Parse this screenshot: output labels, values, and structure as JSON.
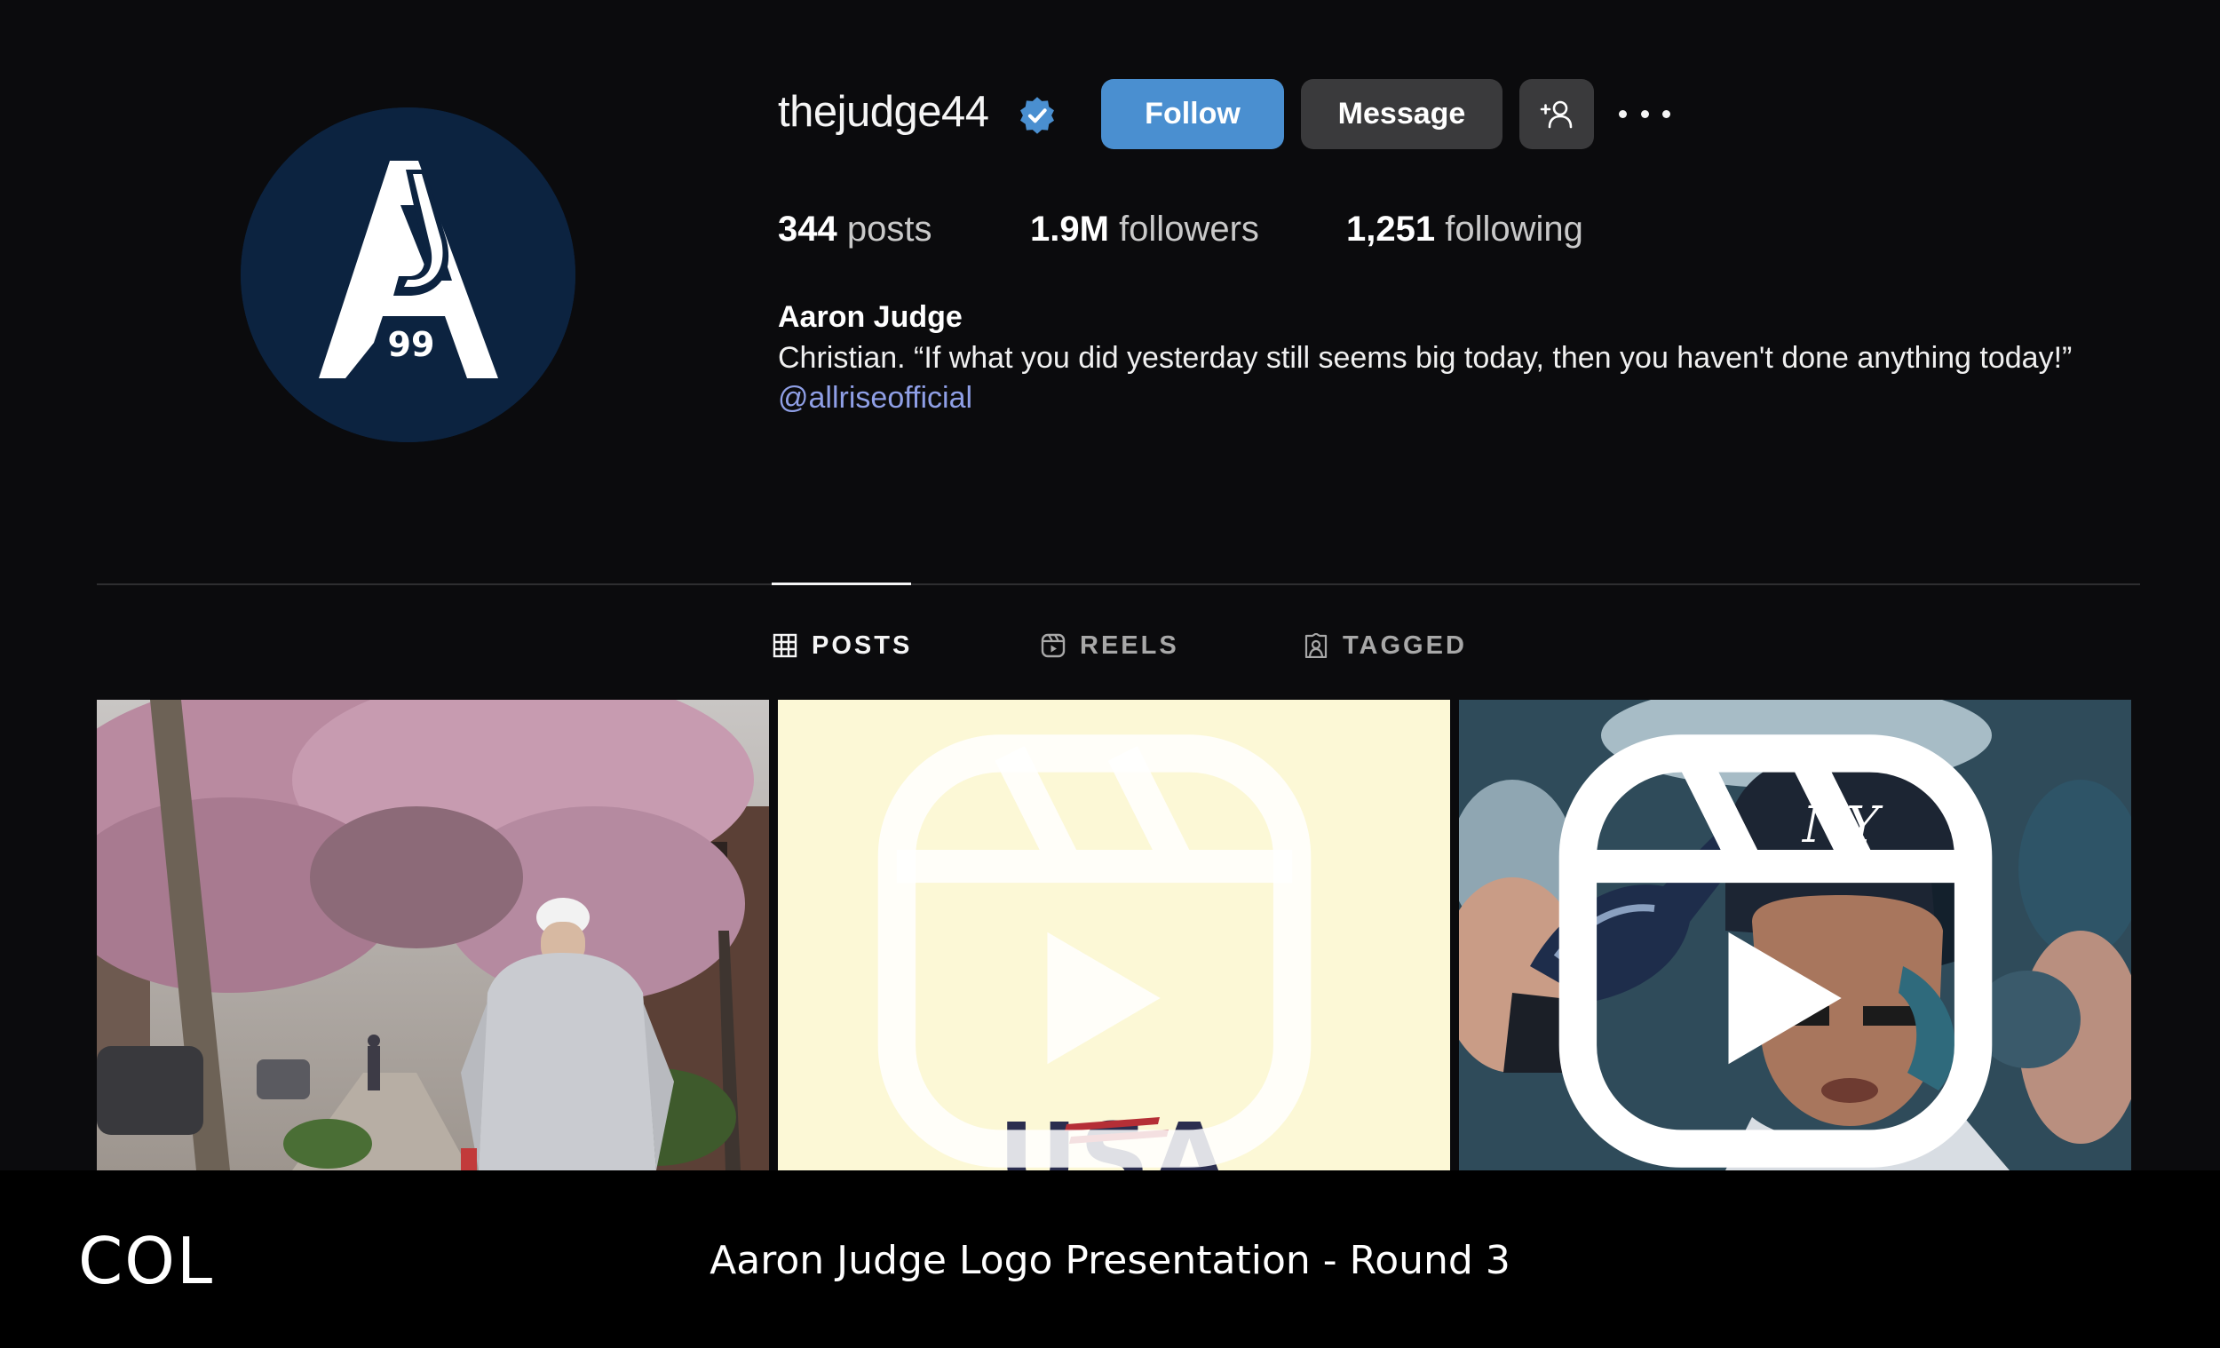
{
  "profile": {
    "username": "thejudge44",
    "verified": true,
    "avatar_logo_text": "99",
    "follow_label": "Follow",
    "message_label": "Message",
    "add_user_icon": "add-user-icon",
    "more_icon": "more-options-icon"
  },
  "stats": {
    "posts_count": "344",
    "posts_label": "posts",
    "followers_count": "1.9M",
    "followers_label": "followers",
    "following_count": "1,251",
    "following_label": "following"
  },
  "bio": {
    "name": "Aaron Judge",
    "text": "Christian. “If what you did yesterday still seems big today, then you haven't done anything today!” ",
    "link": "@allriseofficial"
  },
  "tabs": [
    {
      "label": "POSTS",
      "icon": "grid-icon",
      "active": true
    },
    {
      "label": "REELS",
      "icon": "reels-icon",
      "active": false
    },
    {
      "label": "TAGGED",
      "icon": "tagged-icon",
      "active": false
    }
  ],
  "posts": [
    {
      "type": "photo",
      "description_icon": "photo"
    },
    {
      "type": "reel",
      "overlay_text": "USA",
      "icon": "reel-icon"
    },
    {
      "type": "reel",
      "icon": "reel-icon"
    }
  ],
  "footer": {
    "logo": "COL",
    "caption": "Aaron Judge Logo Presentation - Round 3"
  },
  "colors": {
    "background": "#0b0b0d",
    "follow_button": "#4a8fd0",
    "secondary_button": "#3a3a3c",
    "link": "#8f9fe6",
    "avatar_bg": "#0c2340"
  }
}
